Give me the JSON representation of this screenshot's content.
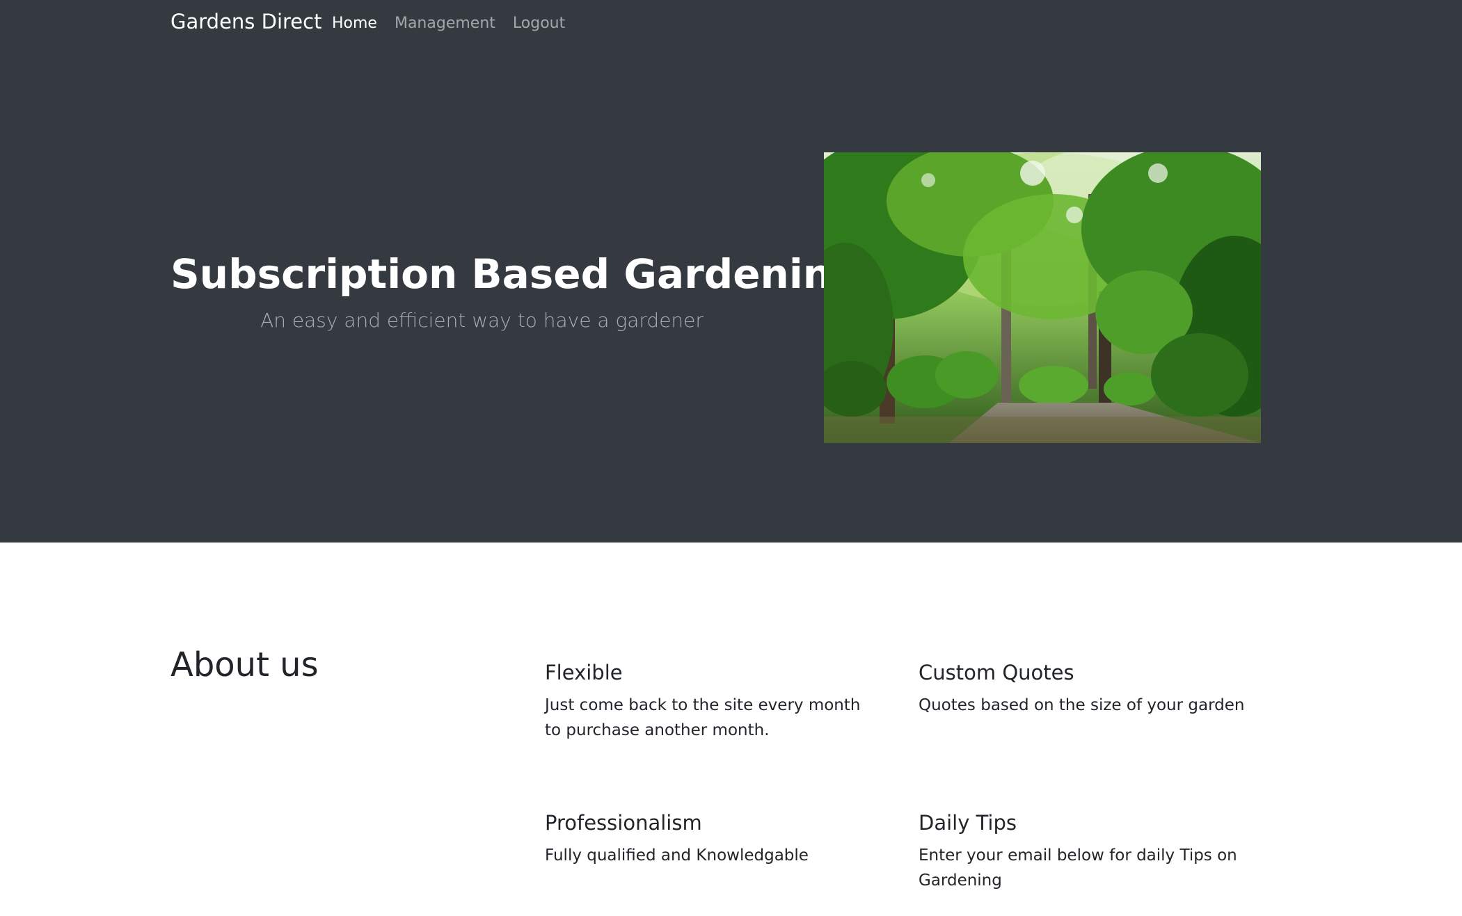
{
  "navbar": {
    "brand": "Gardens Direct",
    "links": [
      {
        "label": "Home",
        "active": true
      },
      {
        "label": "Management",
        "active": false
      },
      {
        "label": "Logout",
        "active": false
      }
    ]
  },
  "hero": {
    "title": "Subscription Based Gardening",
    "subtitle": "An easy and efficient way to have a gardener"
  },
  "about": {
    "title": "About us",
    "features": [
      {
        "title": "Flexible",
        "text": "Just come back to the site every month to purchase another month."
      },
      {
        "title": "Custom Quotes",
        "text": "Quotes based on the size of your garden"
      },
      {
        "title": "Professionalism",
        "text": "Fully qualified and Knowledgable"
      },
      {
        "title": "Daily Tips",
        "text": "Enter your email below for daily Tips on Gardening"
      }
    ]
  },
  "colors": {
    "dark_bg": "#343a40",
    "text_dark": "#212529",
    "nav_muted": "#a9aeb3"
  }
}
